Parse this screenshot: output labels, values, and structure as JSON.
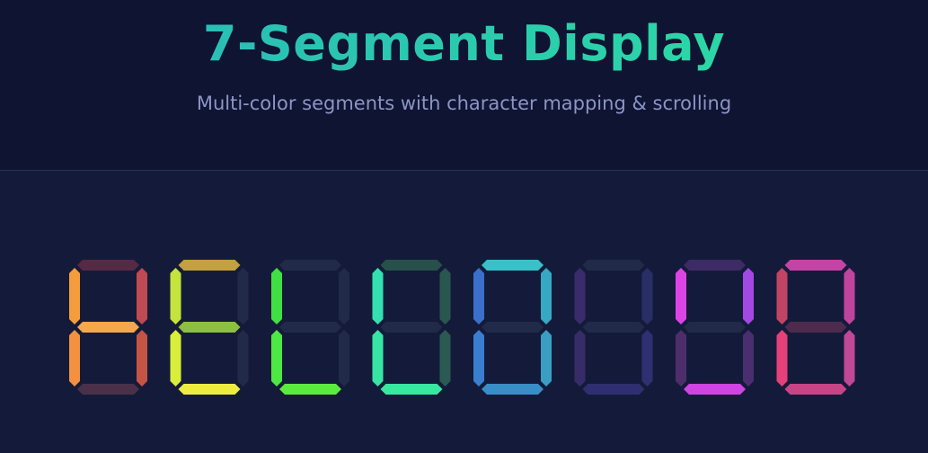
{
  "header": {
    "title": "7-Segment Display",
    "subtitle": "Multi-color segments with character mapping & scrolling"
  },
  "display": {
    "text": "HELLO  UG",
    "off_segment_color": "#222a4a",
    "digits": [
      {
        "segments": {
          "a": "#552a45",
          "b": "#c04a52",
          "c": "#c55444",
          "d": "#4a3048",
          "e": "#f29140",
          "f": "#f59d3c",
          "g": "#f5a84a"
        }
      },
      {
        "segments": {
          "a": "#c3a040",
          "b": "off",
          "c": "off",
          "d": "#eded40",
          "e": "#d8ee3a",
          "f": "#c4e33c",
          "g": "#8ec040"
        }
      },
      {
        "segments": {
          "a": "off",
          "b": "off",
          "c": "off",
          "d": "#5aec3c",
          "e": "#4de843",
          "f": "#40e044",
          "g": "off"
        }
      },
      {
        "segments": {
          "a": "#27504a",
          "b": "#2a5650",
          "c": "#2a5a52",
          "d": "#36e8a0",
          "e": "#38e6a4",
          "f": "#34e0b0",
          "g": "off"
        }
      },
      {
        "segments": {
          "a": "#3ac0c8",
          "b": "#36a8c4",
          "c": "#3a9ec4",
          "d": "#3a8ec8",
          "e": "#3a7ed0",
          "f": "#3a70cc",
          "g": "off"
        }
      },
      {
        "segments": {
          "a": "off",
          "b": "#2a2e66",
          "c": "#2e3072",
          "d": "#2f2f70",
          "e": "#372c68",
          "f": "#3a2c6a",
          "g": "off"
        }
      },
      {
        "segments": {
          "a": "#3d2b66",
          "b": "#a448e4",
          "c": "#4a2e70",
          "d": "#d044e4",
          "e": "#4e2e6a",
          "f": "#dd44e6",
          "g": "off"
        }
      },
      {
        "segments": {
          "a": "#c444a6",
          "b": "#c0449e",
          "c": "#c04896",
          "d": "#c84486",
          "e": "#e6407a",
          "f": "#c24464",
          "g": "#4e2a4c"
        }
      }
    ]
  }
}
